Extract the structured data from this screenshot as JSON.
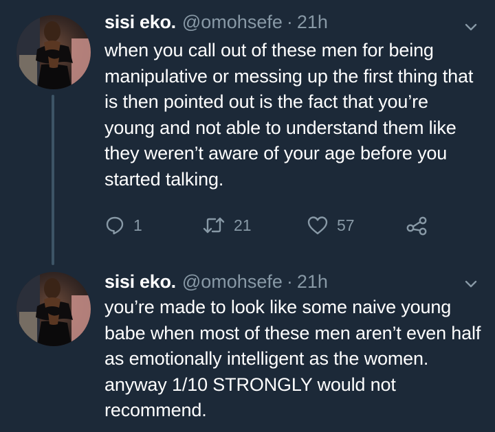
{
  "tweets": [
    {
      "author_name": "sisi eko.",
      "handle": "@omohsefe",
      "separator": "·",
      "time": "21h",
      "text": "when you call out of these men for being manipulative or messing up the first thing that is then pointed out is the fact that you’re young and not able to understand them like they weren’t aware of your age before you started talking.",
      "reply_count": "1",
      "retweet_count": "21",
      "like_count": "57"
    },
    {
      "author_name": "sisi eko.",
      "handle": "@omohsefe",
      "separator": "·",
      "time": "21h",
      "text": "you’re made to look like some naive young babe when most of these men aren’t even half as emotionally intelligent as the women. anyway 1/10 STRONGLY would not recommend."
    }
  ],
  "icons": {
    "menu": "chevron-down-icon",
    "reply": "reply-icon",
    "retweet": "retweet-icon",
    "like": "heart-icon",
    "share": "share-icon"
  },
  "colors": {
    "background": "#1c2938",
    "primary_text": "#ffffff",
    "secondary_text": "#8899a6",
    "thread_line": "#3d5466"
  }
}
